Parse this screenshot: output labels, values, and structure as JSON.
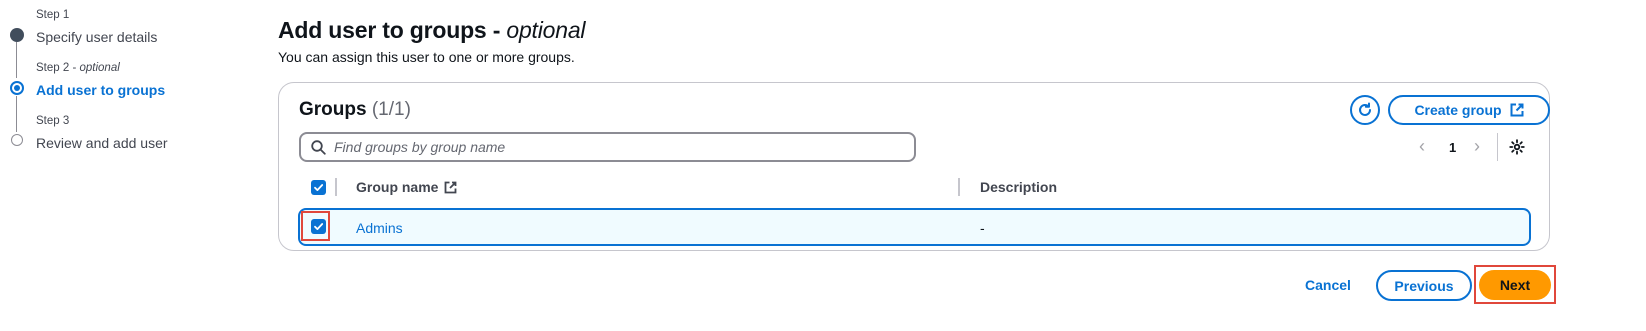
{
  "steps": [
    {
      "meta": "Step 1",
      "meta_suffix": "",
      "title": "Specify user details",
      "state": "done"
    },
    {
      "meta": "Step 2",
      "meta_suffix": "optional",
      "title": "Add user to groups",
      "state": "active"
    },
    {
      "meta": "Step 3",
      "meta_suffix": "",
      "title": "Review and add user",
      "state": "todo"
    }
  ],
  "header": {
    "title": "Add user to groups",
    "title_suffix": "optional",
    "description": "You can assign this user to one or more groups."
  },
  "groups": {
    "title": "Groups",
    "count": "(1/1)",
    "refresh_icon": "refresh-icon",
    "create_label": "Create group",
    "search_placeholder": "Find groups by group name",
    "page_number": "1",
    "columns": {
      "name": "Group name",
      "description": "Description"
    },
    "rows": [
      {
        "name": "Admins",
        "description": "-",
        "selected": true
      }
    ]
  },
  "footer": {
    "cancel_label": "Cancel",
    "previous_label": "Previous",
    "next_label": "Next"
  },
  "colors": {
    "accent": "#0972d3",
    "primary_button": "#ff9900",
    "highlight": "#e0473b"
  }
}
